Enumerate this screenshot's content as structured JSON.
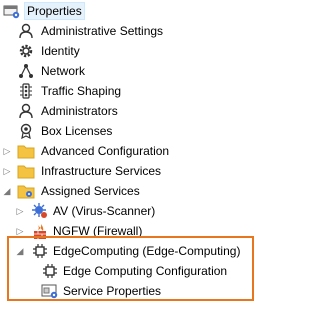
{
  "tree": {
    "properties": "Properties",
    "administrative_settings": "Administrative Settings",
    "identity": "Identity",
    "network": "Network",
    "traffic_shaping": "Traffic Shaping",
    "administrators": "Administrators",
    "box_licenses": "Box Licenses",
    "advanced_configuration": "Advanced Configuration",
    "infrastructure_services": "Infrastructure Services",
    "assigned_services": "Assigned Services",
    "av_service": "AV (Virus-Scanner)",
    "ngfw_service": "NGFW (Firewall)",
    "edge_computing": "EdgeComputing (Edge-Computing)",
    "edge_computing_configuration": "Edge Computing Configuration",
    "service_properties": "Service Properties"
  },
  "colors": {
    "highlight_border": "#e8761e",
    "folder": "#f5c342",
    "gear_blue": "#3d6fd6"
  }
}
